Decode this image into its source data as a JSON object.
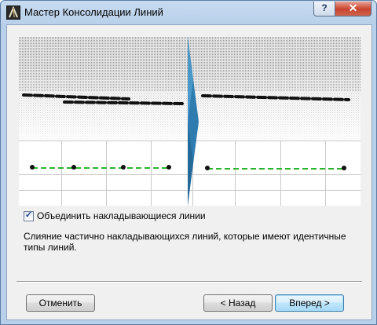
{
  "window": {
    "title": "Мастер Консолидации Линий",
    "help_label": "?",
    "close_label": "✕"
  },
  "icons": {
    "app": "archicad-app-icon",
    "help": "help-icon",
    "close": "close-icon",
    "check": "checkmark-icon",
    "arrow": "right-arrow-icon"
  },
  "options": {
    "merge_overlapping_label": "Объединить накладывающиеся линии",
    "merge_overlapping_checked": true
  },
  "description": "Слияние частично накладывающихся линий, которые имеют идентичные типы линий.",
  "buttons": {
    "cancel": "Отменить",
    "back": "< Назад",
    "next": "Вперед >"
  },
  "colors": {
    "arrow": "#2f7db0",
    "green_line": "#2db52d",
    "black_line": "#111111"
  }
}
